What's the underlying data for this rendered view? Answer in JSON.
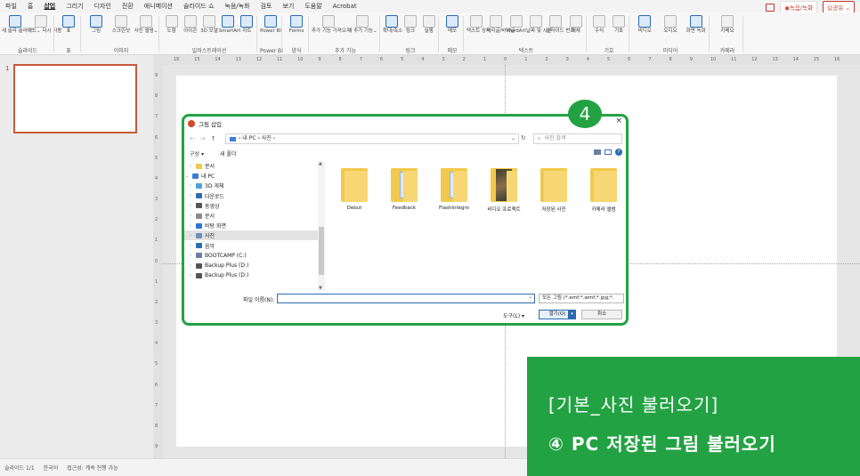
{
  "menubar": {
    "tabs": [
      "파일",
      "홈",
      "삽입",
      "그리기",
      "디자인",
      "전환",
      "애니메이션",
      "슬라이드 쇼",
      "녹음/녹화",
      "검토",
      "보기",
      "도움말",
      "Acrobat"
    ],
    "active_index": 2,
    "record_label": "◉녹음/녹화",
    "share_label": "公공유 ⌄"
  },
  "ribbon": {
    "groups": [
      {
        "label": "슬라이드",
        "buttons": [
          {
            "icon": "new-slide-icon",
            "label": "새 슬라 슬라이드"
          },
          {
            "icon": "reuse-slide-icon",
            "label": "이드⌄ 다시 사용"
          }
        ]
      },
      {
        "label": "표",
        "buttons": [
          {
            "icon": "table-icon",
            "label": "표"
          }
        ]
      },
      {
        "label": "이미지",
        "buttons": [
          {
            "icon": "picture-icon",
            "label": "그림"
          },
          {
            "icon": "screenshot-icon",
            "label": "스크린샷"
          },
          {
            "icon": "album-icon",
            "label": "사진 앨범⌄"
          }
        ]
      },
      {
        "label": "일러스트레이션",
        "buttons": [
          {
            "icon": "shapes-icon",
            "label": "도형"
          },
          {
            "icon": "icons-icon",
            "label": "아이콘"
          },
          {
            "icon": "3d-icon",
            "label": "3D 모델"
          },
          {
            "icon": "smartart-icon",
            "label": "SmartArt"
          },
          {
            "icon": "chart-icon",
            "label": "차트"
          }
        ]
      },
      {
        "label": "Power BI",
        "buttons": [
          {
            "icon": "powerbi-icon",
            "label": "Power BI"
          }
        ]
      },
      {
        "label": "양식",
        "buttons": [
          {
            "icon": "forms-icon",
            "label": "Forms"
          }
        ]
      },
      {
        "label": "추가 기능",
        "buttons": [
          {
            "icon": "addin-icon",
            "label": "추가 기능 가져오기"
          },
          {
            "icon": "my-addin-icon",
            "label": "내 추가 기능⌄"
          }
        ]
      },
      {
        "label": "링크",
        "buttons": [
          {
            "icon": "zoom-icon",
            "label": "확대/축소"
          },
          {
            "icon": "link-icon",
            "label": "링크"
          },
          {
            "icon": "action-icon",
            "label": "실행"
          }
        ]
      },
      {
        "label": "메모",
        "buttons": [
          {
            "icon": "comment-icon",
            "label": "메모"
          }
        ]
      },
      {
        "label": "텍스트",
        "buttons": [
          {
            "icon": "textbox-icon",
            "label": "텍스트 상자"
          },
          {
            "icon": "header-footer-icon",
            "label": "머리글/바닥글"
          },
          {
            "icon": "wordart-icon",
            "label": "WordArt"
          },
          {
            "icon": "datetime-icon",
            "label": "날짜 및 시간"
          },
          {
            "icon": "slidenum-icon",
            "label": "슬라이드 번호"
          },
          {
            "icon": "object-icon",
            "label": "개체"
          }
        ]
      },
      {
        "label": "기호",
        "buttons": [
          {
            "icon": "equation-icon",
            "label": "수식"
          },
          {
            "icon": "symbol-icon",
            "label": "기호"
          }
        ]
      },
      {
        "label": "미디어",
        "buttons": [
          {
            "icon": "video-icon",
            "label": "비디오"
          },
          {
            "icon": "audio-icon",
            "label": "오디오"
          },
          {
            "icon": "screen-record-icon",
            "label": "화면 녹화"
          }
        ]
      },
      {
        "label": "카메라",
        "buttons": [
          {
            "icon": "cameo-icon",
            "label": "카메오"
          }
        ]
      }
    ]
  },
  "slidepane": {
    "slide_number": "1"
  },
  "rulers": {
    "h_ticks": [
      "16",
      "15",
      "14",
      "13",
      "12",
      "11",
      "10",
      "9",
      "8",
      "7",
      "6",
      "5",
      "4",
      "3",
      "2",
      "1",
      "0",
      "1",
      "2",
      "3",
      "4",
      "5",
      "6",
      "7",
      "8",
      "9",
      "10",
      "11",
      "12",
      "13",
      "14",
      "15",
      "16"
    ],
    "v_ticks": [
      "9",
      "8",
      "7",
      "6",
      "5",
      "4",
      "3",
      "2",
      "1",
      "0",
      "1",
      "2",
      "3",
      "4",
      "5",
      "6",
      "7",
      "8",
      "9"
    ]
  },
  "dialog": {
    "title": "그림 삽입",
    "close": "×",
    "back": "←",
    "forward": "→",
    "up": "↑",
    "path": "› 내 PC › 사진 ›",
    "path_dd": "⌄",
    "refresh": "↻",
    "search_placeholder": "사진 검색",
    "organize": "구성 ▾",
    "new_folder": "새 폴더",
    "help": "?",
    "tree": [
      {
        "label": "문서",
        "arrow": "›",
        "color": "#f2c94c"
      },
      {
        "label": "내 PC",
        "arrow": "⌄",
        "color": "#3b7dd8"
      },
      {
        "label": "3D 개체",
        "arrow": "›",
        "color": "#4aa3df"
      },
      {
        "label": "다운로드",
        "arrow": "›",
        "color": "#2b6cb0"
      },
      {
        "label": "동영상",
        "arrow": "›",
        "color": "#555555"
      },
      {
        "label": "문서",
        "arrow": "›",
        "color": "#8a8a8a"
      },
      {
        "label": "바탕 화면",
        "arrow": "›",
        "color": "#2b78d8"
      },
      {
        "label": "사진",
        "arrow": "›",
        "color": "#6b8fb8",
        "selected": true
      },
      {
        "label": "음악",
        "arrow": "›",
        "color": "#2b6cb0"
      },
      {
        "label": "BOOTCAMP (C:)",
        "arrow": "›",
        "color": "#6a7ea8"
      },
      {
        "label": "Backup Plus (D:)",
        "arrow": "›",
        "color": "#555555"
      },
      {
        "label": "Backup Plus (D:)",
        "arrow": "›",
        "color": "#555555"
      }
    ],
    "files": [
      {
        "name": "Debut",
        "kind": "folder"
      },
      {
        "name": "Feedback",
        "kind": "folder-doc"
      },
      {
        "name": "FlashIntegro",
        "kind": "folder-doc"
      },
      {
        "name": "비디오 프로젝트",
        "kind": "folder-photo"
      },
      {
        "name": "저장된 사진",
        "kind": "folder"
      },
      {
        "name": "카메라 앨범",
        "kind": "folder"
      }
    ],
    "filename_label": "파일 이름(N):",
    "filename_value": "",
    "filter": "모든 그림 (*.emf;*.wmf;*.jpg;*.",
    "tools": "도구(L)  ▾",
    "open": "열기(O)",
    "cancel": "취소"
  },
  "badge": "4",
  "overlay": {
    "line1": "[기본_사진 불러오기]",
    "line2": "④ PC 저장된 그림 불러오기"
  },
  "statusbar": {
    "slide": "슬라이드 1/1",
    "lang": "한국어",
    "access": "접근성: 계속 진행 가능"
  }
}
